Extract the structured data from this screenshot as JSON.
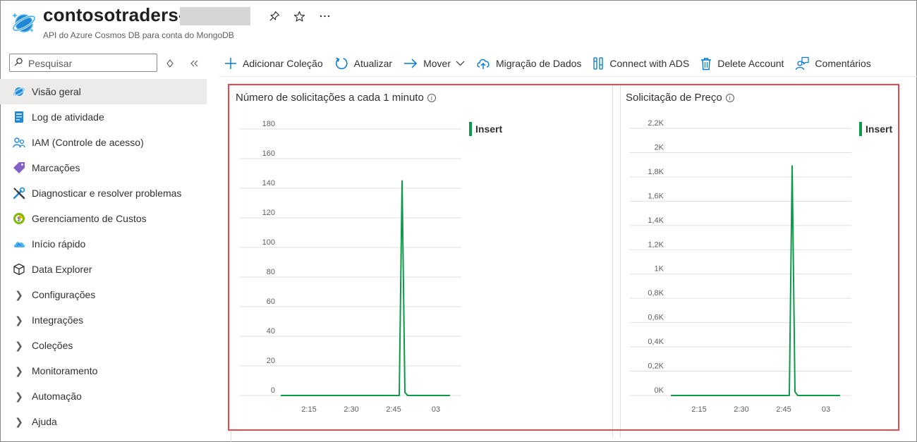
{
  "header": {
    "title": "contosotraders-",
    "subtitle": "API do Azure Cosmos DB para conta do MongoDB",
    "icons": [
      "pin-icon",
      "star-icon",
      "more-icon"
    ]
  },
  "search": {
    "placeholder": "Pesquisar"
  },
  "sidebar": {
    "items": [
      {
        "label": "Visão geral",
        "icon": "cosmos-icon",
        "active": true
      },
      {
        "label": "Log de atividade",
        "icon": "log-icon"
      },
      {
        "label": "IAM (Controle de acesso)",
        "icon": "iam-icon"
      },
      {
        "label": "Marcações",
        "icon": "tag-icon"
      },
      {
        "label": "Diagnosticar e resolver problemas",
        "icon": "wrench-icon"
      },
      {
        "label": "Gerenciamento de Custos",
        "icon": "cost-icon"
      },
      {
        "label": "Início rápido",
        "icon": "cloud-icon"
      },
      {
        "label": "Data Explorer",
        "icon": "cube-icon"
      },
      {
        "label": "Configurações",
        "icon": "chevron-right-icon"
      },
      {
        "label": "Integrações",
        "icon": "chevron-right-icon"
      },
      {
        "label": "Coleções",
        "icon": "chevron-right-icon"
      },
      {
        "label": "Monitoramento",
        "icon": "chevron-right-icon"
      },
      {
        "label": "Automação",
        "icon": "chevron-right-icon"
      },
      {
        "label": "Ajuda",
        "icon": "chevron-right-icon"
      }
    ]
  },
  "toolbar": {
    "add_collection": "Adicionar Coleção",
    "refresh": "Atualizar",
    "move": "Mover",
    "migration": "Migração de Dados",
    "connect_ads": "Connect with ADS",
    "delete_account": "Delete Account",
    "feedback": "Comentários"
  },
  "colors": {
    "accent": "#0078d4",
    "series": "#0c9a4a",
    "highlight": "#e8474f"
  },
  "chart_data": [
    {
      "type": "line",
      "title": "Número de solicitações a cada 1 minuto",
      "x_ticks": [
        "2:15",
        "2:30",
        "2:45",
        "03"
      ],
      "y_ticks": [
        "0",
        "20",
        "40",
        "60",
        "80",
        "100",
        "120",
        "140",
        "160",
        "180"
      ],
      "ylim": [
        0,
        180
      ],
      "legend": "top-right",
      "series": [
        {
          "name": "Insert",
          "color": "#0c9a4a",
          "x": [
            "2:05",
            "2:47",
            "2:48",
            "2:49",
            "2:50",
            "3:05"
          ],
          "values": [
            0,
            0,
            145,
            2,
            0,
            0
          ]
        }
      ]
    },
    {
      "type": "line",
      "title": "Solicitação de Preço",
      "x_ticks": [
        "2:15",
        "2:30",
        "2:45",
        "03"
      ],
      "y_ticks": [
        "0K",
        "0,2K",
        "0,4K",
        "0,6K",
        "0,8K",
        "1K",
        "1,2K",
        "1,4K",
        "1,6K",
        "1,8K",
        "2K",
        "2,2K"
      ],
      "ylim": [
        0,
        2200
      ],
      "legend": "top-right",
      "series": [
        {
          "name": "Insert",
          "color": "#0c9a4a",
          "x": [
            "2:05",
            "2:47",
            "2:48",
            "2:49",
            "2:50",
            "3:05"
          ],
          "values": [
            0,
            0,
            1890,
            30,
            0,
            0
          ]
        }
      ]
    }
  ]
}
